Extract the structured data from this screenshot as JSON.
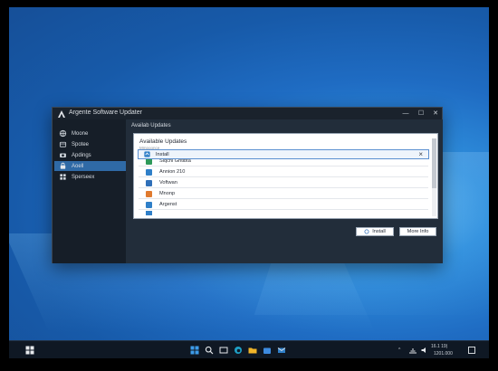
{
  "window": {
    "title": "Argente Software Updater",
    "controls": {
      "minimize": "—",
      "maximize": "☐",
      "close": "✕"
    }
  },
  "sidebar": {
    "items": [
      {
        "label": "Moone",
        "icon": "globe-icon"
      },
      {
        "label": "Spotee",
        "icon": "shop-icon"
      },
      {
        "label": "Apdings",
        "icon": "camera-icon"
      },
      {
        "label": "Aoell",
        "icon": "lock-icon",
        "active": true
      },
      {
        "label": "Sperseex",
        "icon": "grid-icon"
      }
    ]
  },
  "content": {
    "header": "Availab Updates",
    "panel": {
      "title": "Available Updates",
      "caption": "Mmpoonce",
      "install_row_label": "Install",
      "rows": [
        {
          "label": "Siqchl Ghtlbta",
          "icon_color": "#2f9a5a"
        },
        {
          "label": "Annion 210",
          "icon_color": "#2f7fc8"
        },
        {
          "label": "Voftwan",
          "icon_color": "#2f6fb8"
        },
        {
          "label": "Mnonp",
          "icon_color": "#e07a2e"
        },
        {
          "label": "Argenst",
          "icon_color": "#2f7fc8"
        }
      ]
    },
    "buttons": {
      "install": "Install",
      "more_info": "More Info"
    }
  },
  "taskbar": {
    "clock_time": "16.1 19)",
    "clock_date": "1201.000",
    "tray_glyph": "^"
  }
}
